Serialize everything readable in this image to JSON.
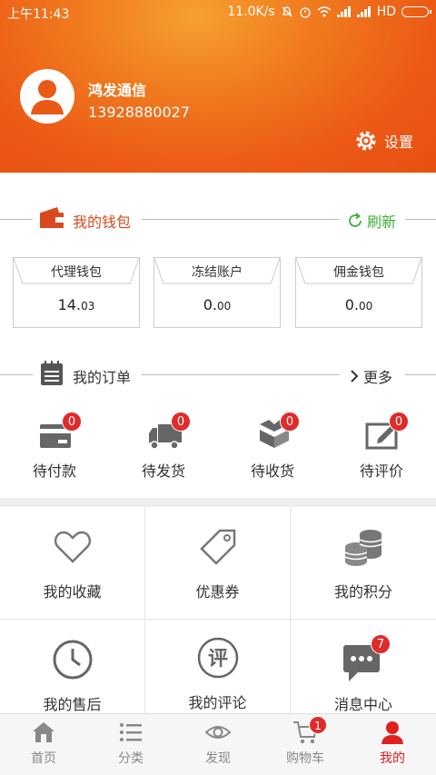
{
  "status_bar": {
    "time": "上午11:43",
    "speed": "11.0K/s",
    "network": "HD"
  },
  "user": {
    "name": "鸿发通信",
    "phone": "13928880027"
  },
  "settings_label": "设置",
  "wallet": {
    "title": "我的钱包",
    "refresh_label": "刷新",
    "cards": [
      {
        "title": "代理钱包",
        "value_int": "14.",
        "value_dec": "03"
      },
      {
        "title": "冻结账户",
        "value_int": "0.",
        "value_dec": "00"
      },
      {
        "title": "佣金钱包",
        "value_int": "0.",
        "value_dec": "00"
      }
    ]
  },
  "orders": {
    "title": "我的订单",
    "more_label": "更多",
    "statuses": [
      {
        "label": "待付款",
        "count": "0",
        "icon": "card-icon"
      },
      {
        "label": "待发货",
        "count": "0",
        "icon": "truck-icon"
      },
      {
        "label": "待收货",
        "count": "0",
        "icon": "box-icon"
      },
      {
        "label": "待评价",
        "count": "0",
        "icon": "edit-icon"
      }
    ]
  },
  "grid": [
    {
      "label": "我的收藏",
      "icon": "heart-icon"
    },
    {
      "label": "优惠券",
      "icon": "tag-icon"
    },
    {
      "label": "我的积分",
      "icon": "coins-icon"
    },
    {
      "label": "我的售后",
      "icon": "clock-icon"
    },
    {
      "label": "我的评论",
      "icon": "comment-badge-icon"
    },
    {
      "label": "消息中心",
      "icon": "message-icon",
      "badge": "7"
    }
  ],
  "nav": [
    {
      "label": "首页",
      "icon": "home-icon"
    },
    {
      "label": "分类",
      "icon": "list-icon"
    },
    {
      "label": "发现",
      "icon": "eye-icon"
    },
    {
      "label": "购物车",
      "icon": "cart-icon",
      "badge": "1"
    },
    {
      "label": "我的",
      "icon": "user-icon",
      "active": true
    }
  ],
  "colors": {
    "brand": "#e84f12",
    "accent_red": "#e02b2b",
    "refresh_green": "#3cb034",
    "wallet_red": "#d9491f"
  }
}
